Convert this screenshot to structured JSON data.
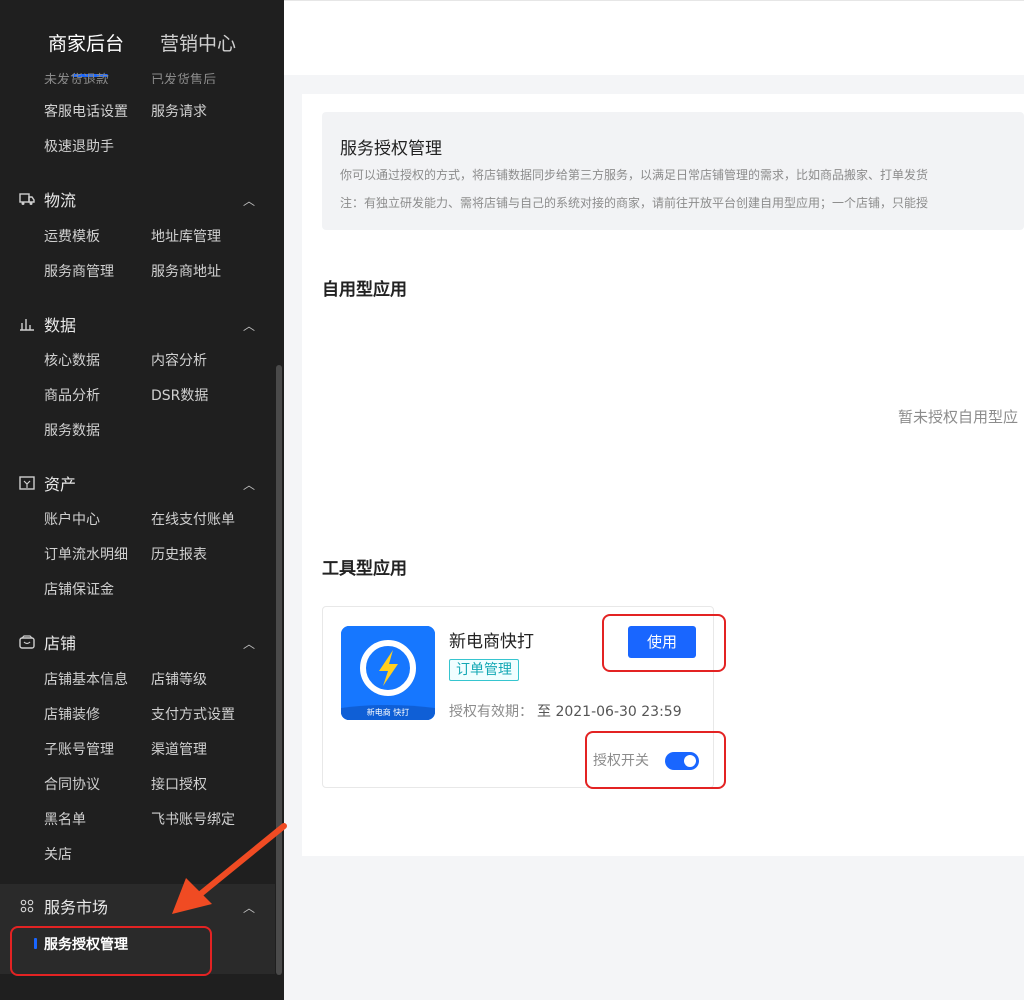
{
  "nav": {
    "tabs": [
      "商家后台",
      "营销中心"
    ],
    "cut_row": [
      "未发货退款",
      "已发货售后"
    ]
  },
  "sidebar": {
    "top_items": [
      "客服电话设置",
      "服务请求",
      "极速退助手"
    ],
    "sections": [
      {
        "title": "物流",
        "icon": "truck-icon",
        "items": [
          "运费模板",
          "地址库管理",
          "服务商管理",
          "服务商地址"
        ]
      },
      {
        "title": "数据",
        "icon": "bar-chart-icon",
        "items": [
          "核心数据",
          "内容分析",
          "商品分析",
          "DSR数据",
          "服务数据"
        ]
      },
      {
        "title": "资产",
        "icon": "wallet-icon",
        "items": [
          "账户中心",
          "在线支付账单",
          "订单流水明细",
          "历史报表",
          "店铺保证金"
        ]
      },
      {
        "title": "店铺",
        "icon": "shop-icon",
        "items": [
          "店铺基本信息",
          "店铺等级",
          "店铺装修",
          "支付方式设置",
          "子账号管理",
          "渠道管理",
          "合同协议",
          "接口授权",
          "黑名单",
          "飞书账号绑定",
          "关店"
        ]
      },
      {
        "title": "服务市场",
        "icon": "grid-icon",
        "items": [
          "服务授权管理"
        ]
      }
    ]
  },
  "main": {
    "info": {
      "title": "服务授权管理",
      "desc": "你可以通过授权的方式，将店铺数据同步给第三方服务，以满足日常店铺管理的需求，比如商品搬家、打单发货",
      "note": "注：有独立研发能力、需将店铺与自己的系统对接的商家，请前往开放平台创建自用型应用；一个店铺，只能授"
    },
    "self_apps": {
      "title": "自用型应用",
      "empty": "暂未授权自用型应"
    },
    "tool_apps": {
      "title": "工具型应用",
      "app": {
        "name": "新电商快打",
        "tag": "订单管理",
        "expire_label": "授权有效期：",
        "expire_value": "至 2021-06-30 23:59",
        "use_button": "使用",
        "switch_label": "授权开关",
        "switch_on": true,
        "icon_text": "新电商 快打"
      }
    }
  },
  "colors": {
    "accent": "#1966ff",
    "sidebar_bg": "#1f1f1f",
    "highlight": "#e32323",
    "arrow": "#f04b23"
  }
}
